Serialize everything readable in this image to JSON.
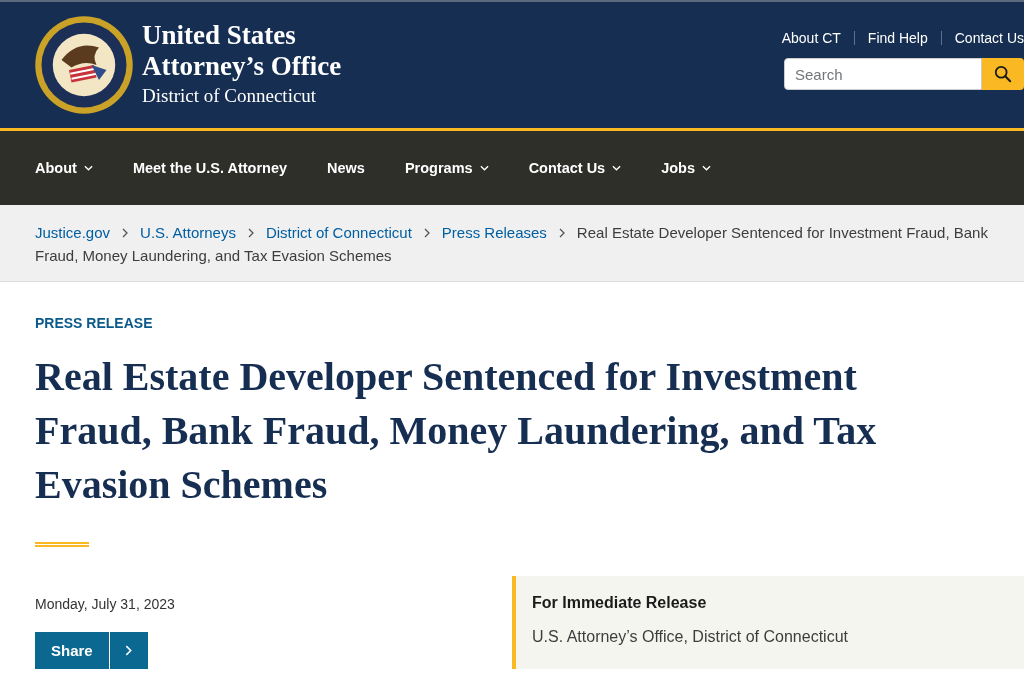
{
  "header": {
    "title_line_1": "United States",
    "title_line_2": "Attorney’s Office",
    "subtitle": "District of Connecticut",
    "utility_links": [
      "About CT",
      "Find Help",
      "Contact Us"
    ],
    "search": {
      "placeholder": "Search"
    }
  },
  "nav": [
    {
      "label": "About",
      "has_menu": true
    },
    {
      "label": "Meet the U.S. Attorney",
      "has_menu": false
    },
    {
      "label": "News",
      "has_menu": false
    },
    {
      "label": "Programs",
      "has_menu": true
    },
    {
      "label": "Contact Us",
      "has_menu": true
    },
    {
      "label": "Jobs",
      "has_menu": true
    }
  ],
  "breadcrumb": [
    {
      "label": "Justice.gov",
      "kind": "link"
    },
    {
      "label": "U.S. Attorneys",
      "kind": "link"
    },
    {
      "label": "District of Connecticut",
      "kind": "link"
    },
    {
      "label": "Press Releases",
      "kind": "link"
    },
    {
      "label": "Real Estate Developer Sentenced for Investment Fraud, Bank Fraud, Money Laundering, and Tax Evasion Schemes",
      "kind": "current"
    }
  ],
  "article": {
    "eyebrow": "PRESS RELEASE",
    "title": "Real Estate Developer Sentenced for Investment Fraud, Bank Fraud, Money Laundering, and Tax Evasion Schemes",
    "date": "Monday, July 31, 2023",
    "share_label": "Share",
    "release": {
      "heading": "For Immediate Release",
      "source": "U.S. Attorney’s Office, District of Connecticut"
    }
  }
}
